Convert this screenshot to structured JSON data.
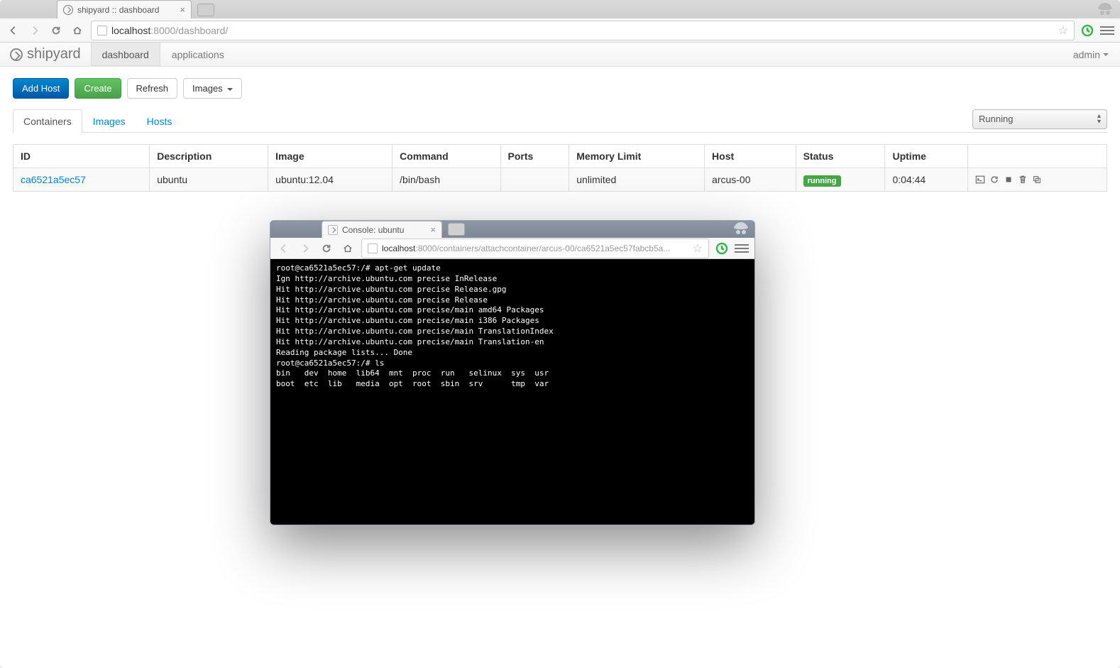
{
  "main_window": {
    "tab_title": "shipyard :: dashboard",
    "url_host": "localhost",
    "url_port_path": ":8000/dashboard/"
  },
  "navbar": {
    "brand": "shipyard",
    "items": [
      "dashboard",
      "applications"
    ],
    "active_index": 0,
    "user": "admin"
  },
  "toolbar": {
    "add_host": "Add Host",
    "create": "Create",
    "refresh": "Refresh",
    "images": "Images"
  },
  "tabs": {
    "items": [
      "Containers",
      "Images",
      "Hosts"
    ],
    "active_index": 0,
    "filter_value": "Running"
  },
  "table": {
    "headers": [
      "ID",
      "Description",
      "Image",
      "Command",
      "Ports",
      "Memory Limit",
      "Host",
      "Status",
      "Uptime",
      ""
    ],
    "rows": [
      {
        "id": "ca6521a5ec57",
        "description": "ubuntu",
        "image": "ubuntu:12.04",
        "command": "/bin/bash",
        "ports": "",
        "memory_limit": "unlimited",
        "host": "arcus-00",
        "status": "running",
        "uptime": "0:04:44"
      }
    ]
  },
  "console_window": {
    "tab_title": "Console: ubuntu",
    "url_host": "localhost",
    "url_port_path": ":8000/containers/attachcontainer/arcus-00/ca6521a5ec57fabcb5a...",
    "terminal": "root@ca6521a5ec57:/# apt-get update\nIgn http://archive.ubuntu.com precise InRelease\nHit http://archive.ubuntu.com precise Release.gpg\nHit http://archive.ubuntu.com precise Release\nHit http://archive.ubuntu.com precise/main amd64 Packages\nHit http://archive.ubuntu.com precise/main i386 Packages\nHit http://archive.ubuntu.com precise/main TranslationIndex\nHit http://archive.ubuntu.com precise/main Translation-en\nReading package lists... Done\nroot@ca6521a5ec57:/# ls\nbin   dev  home  lib64  mnt  proc  run   selinux  sys  usr\nboot  etc  lib   media  opt  root  sbin  srv      tmp  var"
  }
}
